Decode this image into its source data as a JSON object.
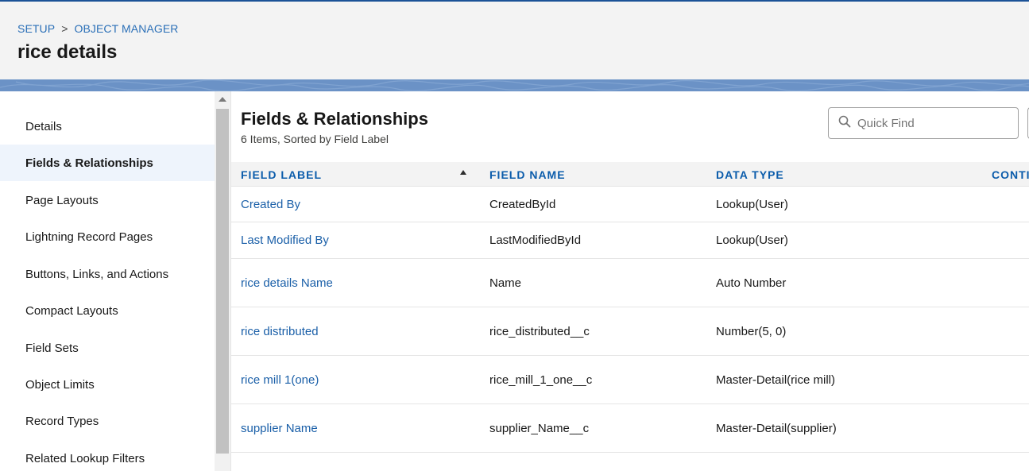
{
  "header": {
    "breadcrumb": [
      "SETUP",
      "OBJECT MANAGER"
    ],
    "breadcrumb_separator": ">",
    "title": "rice details"
  },
  "sidebar": {
    "items": [
      {
        "label": "Details",
        "active": false
      },
      {
        "label": "Fields & Relationships",
        "active": true
      },
      {
        "label": "Page Layouts",
        "active": false
      },
      {
        "label": "Lightning Record Pages",
        "active": false
      },
      {
        "label": "Buttons, Links, and Actions",
        "active": false
      },
      {
        "label": "Compact Layouts",
        "active": false
      },
      {
        "label": "Field Sets",
        "active": false
      },
      {
        "label": "Object Limits",
        "active": false
      },
      {
        "label": "Record Types",
        "active": false
      },
      {
        "label": "Related Lookup Filters",
        "active": false
      }
    ]
  },
  "main": {
    "title": "Fields & Relationships",
    "subtitle": "6 Items, Sorted by Field Label",
    "search": {
      "placeholder": "Quick Find",
      "value": ""
    },
    "table": {
      "columns": [
        "FIELD LABEL",
        "FIELD NAME",
        "DATA TYPE",
        "CONTI"
      ],
      "sorted_column": "FIELD LABEL",
      "sort_direction": "ascending",
      "rows": [
        {
          "label": "Created By",
          "name": "CreatedById",
          "type": "Lookup(User)"
        },
        {
          "label": "Last Modified By",
          "name": "LastModifiedById",
          "type": "Lookup(User)"
        },
        {
          "label": "rice details Name",
          "name": "Name",
          "type": "Auto Number"
        },
        {
          "label": "rice distributed",
          "name": "rice_distributed__c",
          "type": "Number(5, 0)"
        },
        {
          "label": "rice mill 1(one)",
          "name": "rice_mill_1_one__c",
          "type": "Master-Detail(rice mill)"
        },
        {
          "label": "supplier Name",
          "name": "supplier_Name__c",
          "type": "Master-Detail(supplier)"
        }
      ]
    }
  },
  "colors": {
    "link": "#1a5fa8",
    "header_accent": "#1b5297",
    "band": "#6b92c6",
    "active_item_bg": "#eef4fc"
  }
}
